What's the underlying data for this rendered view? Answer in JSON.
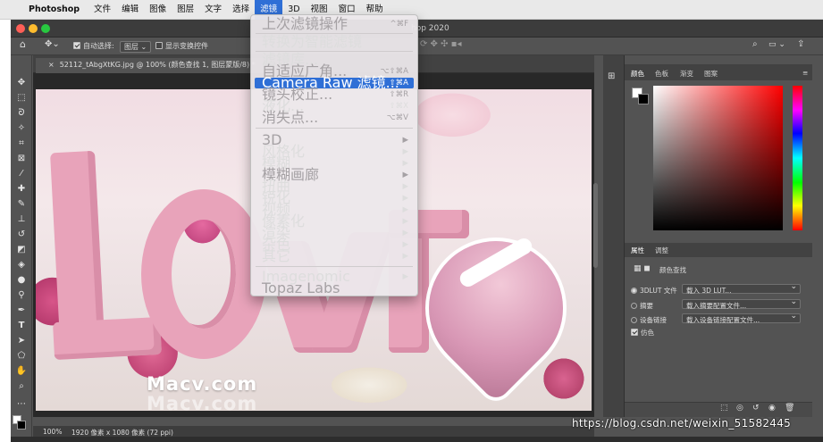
{
  "menubar": {
    "app": "Photoshop",
    "items": [
      "文件",
      "编辑",
      "图像",
      "图层",
      "文字",
      "选择",
      "滤镜",
      "3D",
      "视图",
      "窗口",
      "帮助"
    ],
    "active": "滤镜"
  },
  "window": {
    "title_visible": "hop 2020"
  },
  "options_bar": {
    "auto_select_label": "自动选择:",
    "auto_select_target": "图层",
    "show_transform_label": "显示变换控件",
    "auto_select_checked": true,
    "show_transform_checked": false
  },
  "document": {
    "tab_title": "52112_tAbgXtKG.jpg @ 100% (颜色查找 1, 图层蒙版/8) *",
    "zoom": "100%",
    "info": "1920 像素 x 1080 像素 (72 ppi)",
    "watermark": "Macv.com"
  },
  "filter_menu": {
    "items": [
      {
        "label": "上次滤镜操作",
        "shortcut": "^⌘F",
        "enabled": false
      },
      {
        "label": "转换为智能滤镜",
        "shortcut": "",
        "enabled": true
      },
      {
        "label": "滤镜库...",
        "shortcut": "",
        "enabled": true
      },
      {
        "label": "自适应广角...",
        "shortcut": "⌥⇧⌘A",
        "enabled": false
      },
      {
        "label": "Camera Raw 滤镜...",
        "shortcut": "⇧⌘A",
        "enabled": true,
        "highlighted": true
      },
      {
        "label": "镜头校正...",
        "shortcut": "⇧⌘R",
        "enabled": false
      },
      {
        "label": "液化...",
        "shortcut": "⇧⌘X",
        "enabled": true
      },
      {
        "label": "消失点...",
        "shortcut": "⌥⌘V",
        "enabled": false
      },
      {
        "label": "3D",
        "shortcut": "▶",
        "enabled": false
      },
      {
        "label": "风格化",
        "shortcut": "▶",
        "enabled": true
      },
      {
        "label": "模糊",
        "shortcut": "▶",
        "enabled": true
      },
      {
        "label": "模糊画廊",
        "shortcut": "▶",
        "enabled": false
      },
      {
        "label": "扭曲",
        "shortcut": "▶",
        "enabled": true
      },
      {
        "label": "锐化",
        "shortcut": "▶",
        "enabled": true
      },
      {
        "label": "视频",
        "shortcut": "▶",
        "enabled": true
      },
      {
        "label": "像素化",
        "shortcut": "▶",
        "enabled": true
      },
      {
        "label": "渲染",
        "shortcut": "▶",
        "enabled": true
      },
      {
        "label": "杂色",
        "shortcut": "▶",
        "enabled": true
      },
      {
        "label": "其它",
        "shortcut": "▶",
        "enabled": true
      },
      {
        "label": "Imagenomic",
        "shortcut": "▶",
        "enabled": true
      },
      {
        "label": "Topaz Labs",
        "shortcut": "",
        "enabled": false
      }
    ]
  },
  "color_panel": {
    "tabs": [
      "颜色",
      "色板",
      "渐变",
      "图案"
    ],
    "active": "颜色",
    "hue": "#ff0000",
    "foreground": "#ffffff",
    "background": "#000000"
  },
  "properties_panel": {
    "tabs": [
      "属性",
      "调整"
    ],
    "active": "属性",
    "layer_type": "颜色查找",
    "rows": [
      {
        "label": "3DLUT 文件",
        "value": "载入 3D LUT...",
        "selected": true
      },
      {
        "label": "摘要",
        "value": "载入摘要配置文件...",
        "selected": false
      },
      {
        "label": "设备链接",
        "value": "载入设备链接配置文件...",
        "selected": false
      }
    ],
    "dither_label": "仿色",
    "dither_checked": true
  },
  "overlay": {
    "url": "https://blog.csdn.net/weixin_51582445"
  }
}
